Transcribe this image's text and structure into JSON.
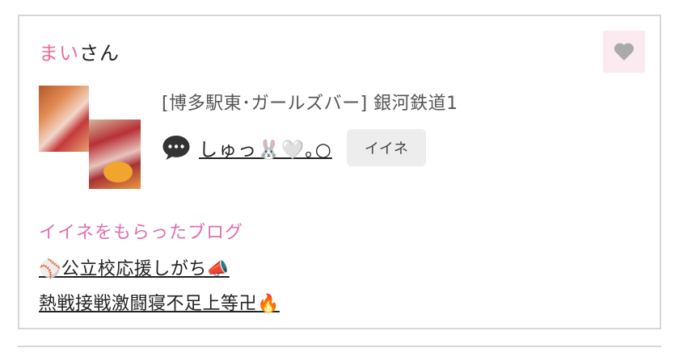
{
  "user": {
    "name": "まい",
    "suffix": "さん"
  },
  "post": {
    "title": "[博多駅東･ガールズバー]  銀河鉄道1"
  },
  "comment": {
    "commenter": "しゅっ🐰🤍｡○"
  },
  "buttons": {
    "iine_label": "イイネ"
  },
  "liked_blogs": {
    "title": "イイネをもらったブログ",
    "items": [
      {
        "label": "⚾公立校応援しがち📣"
      },
      {
        "label": "熱戦接戦激闘寝不足上等卍🔥"
      }
    ]
  },
  "icons": {
    "like": "heart-icon",
    "comment": "speech-bubble-icon"
  },
  "colors": {
    "user_name": "#e8709a",
    "section_title": "#e06eb1",
    "like_box_bg": "#fbeaf0",
    "heart": "#aaaaaa"
  }
}
